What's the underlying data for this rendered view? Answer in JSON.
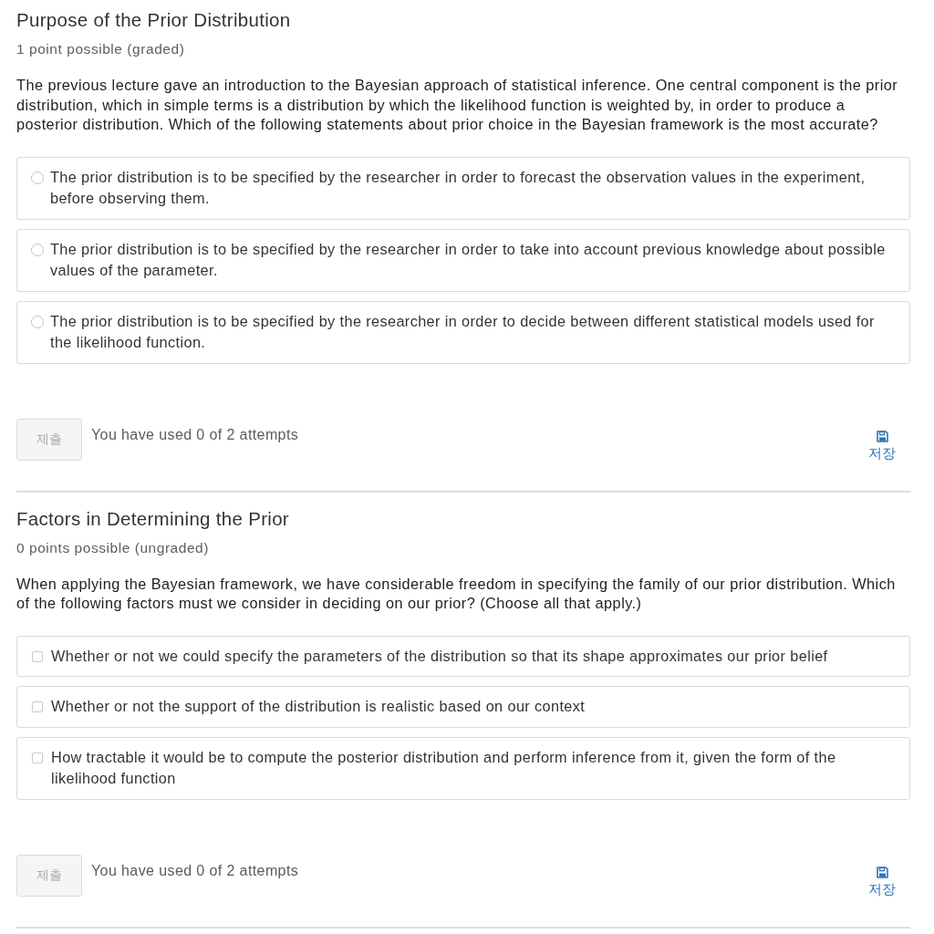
{
  "problems": [
    {
      "title": "Purpose of the Prior Distribution",
      "points": "1 point possible (graded)",
      "prompt": "The previous lecture gave an introduction to the Bayesian approach of statistical inference. One central component is the prior distribution, which in simple terms is a distribution by which the likelihood function is weighted by, in order to produce a posterior distribution. Which of the following statements about prior choice in the Bayesian framework is the most accurate?",
      "kind": "single",
      "options": [
        {
          "label": "The prior distribution is to be specified by the researcher in order to forecast the observation values in the experiment, before observing them.",
          "selected": false
        },
        {
          "label": "The prior distribution is to be specified by the researcher in order to take into account previous knowledge about possible values of the parameter.",
          "selected": false
        },
        {
          "label": "The prior distribution is to be specified by the researcher in order to decide between different statistical models used for the likelihood function.",
          "selected": false
        }
      ],
      "submit": {
        "label": "제출",
        "disabled": true
      },
      "attempts": "You have used 0 of 2 attempts",
      "save": {
        "label": "저장"
      }
    },
    {
      "title": "Factors in Determining the Prior",
      "points": "0 points possible (ungraded)",
      "prompt": "When applying the Bayesian framework, we have considerable freedom in specifying the family of our prior distribution. Which of the following factors must we consider in deciding on our prior? (Choose all that apply.)",
      "kind": "multiple",
      "options": [
        {
          "label": "Whether or not we could specify the parameters of the distribution so that its shape approximates our prior belief",
          "selected": false
        },
        {
          "label": "Whether or not the support of the distribution is realistic based on our context",
          "selected": false
        },
        {
          "label": "How tractable it would be to compute the posterior distribution and perform inference from it, given the form of the likelihood function",
          "selected": false
        }
      ],
      "submit": {
        "label": "제출",
        "disabled": true
      },
      "attempts": "You have used 0 of 2 attempts",
      "save": {
        "label": "저장"
      }
    }
  ]
}
